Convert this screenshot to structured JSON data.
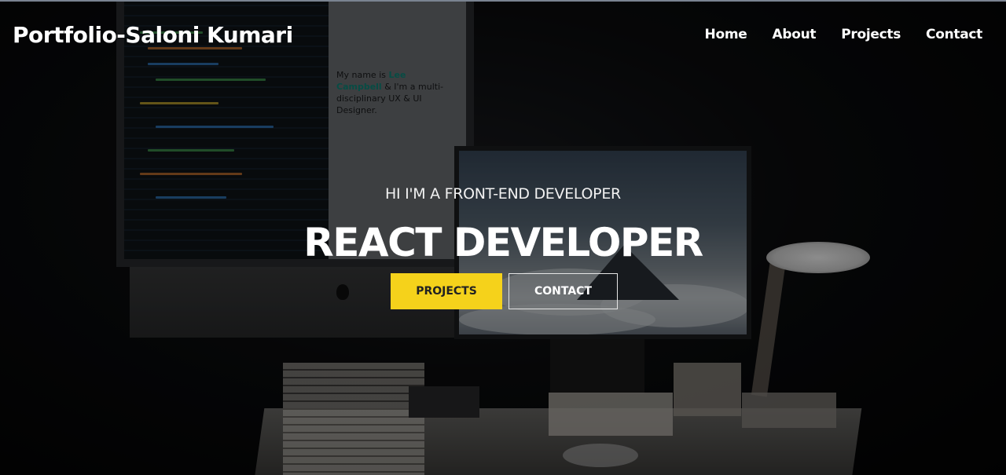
{
  "navbar": {
    "brand": "Portfolio-Saloni Kumari",
    "links": [
      {
        "label": "Home"
      },
      {
        "label": "About"
      },
      {
        "label": "Projects"
      },
      {
        "label": "Contact"
      }
    ]
  },
  "hero": {
    "subtitle": "HI I'M A FRONT-END DEVELOPER",
    "title": "REACT DEVELOPER",
    "primary_button": "PROJECTS",
    "secondary_button": "CONTACT"
  },
  "background_photo": {
    "screen_text_1": "My name is",
    "screen_highlight": "Lee Campbell",
    "screen_text_2": "& I'm a multi-disciplinary UX & UI Designer."
  },
  "colors": {
    "accent": "#f5d21b",
    "text": "#ffffff",
    "background": "#000000"
  }
}
